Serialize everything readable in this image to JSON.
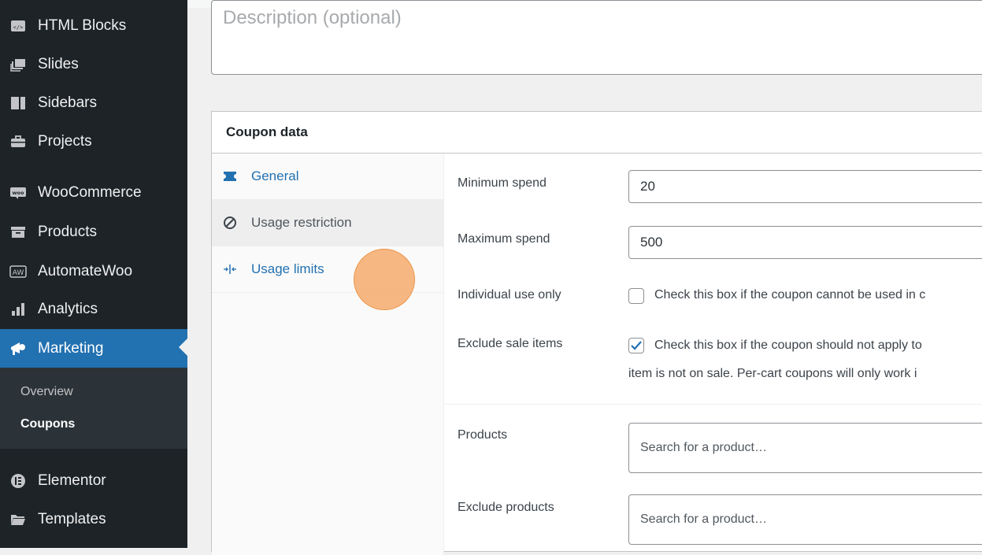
{
  "sidebar": {
    "items": [
      {
        "label": "HTML Blocks",
        "icon": "html-blocks-icon"
      },
      {
        "label": "Slides",
        "icon": "slides-icon"
      },
      {
        "label": "Sidebars",
        "icon": "sidebars-icon"
      },
      {
        "label": "Projects",
        "icon": "briefcase-icon"
      },
      {
        "label": "WooCommerce",
        "icon": "woo-icon"
      },
      {
        "label": "Products",
        "icon": "archive-icon"
      },
      {
        "label": "AutomateWoo",
        "icon": "aw-icon"
      },
      {
        "label": "Analytics",
        "icon": "bar-chart-icon"
      },
      {
        "label": "Marketing",
        "icon": "megaphone-icon"
      },
      {
        "label": "Elementor",
        "icon": "elementor-icon"
      },
      {
        "label": "Templates",
        "icon": "folder-icon"
      }
    ],
    "submenu": [
      {
        "label": "Overview"
      },
      {
        "label": "Coupons"
      }
    ],
    "active_color": "#2271b1"
  },
  "description": {
    "placeholder": "Description (optional)"
  },
  "coupon_data": {
    "title": "Coupon data",
    "tabs": [
      {
        "label": "General",
        "icon": "ticket-icon"
      },
      {
        "label": "Usage restriction",
        "icon": "block-icon"
      },
      {
        "label": "Usage limits",
        "icon": "limits-icon"
      }
    ],
    "fields": {
      "min_spend": {
        "label": "Minimum spend",
        "value": "20"
      },
      "max_spend": {
        "label": "Maximum spend",
        "value": "500"
      },
      "individual_use": {
        "label": "Individual use only",
        "text": "Check this box if the coupon cannot be used in c",
        "checked": false
      },
      "exclude_sale": {
        "label": "Exclude sale items",
        "text": "Check this box if the coupon should not apply to",
        "text2": "item is not on sale. Per-cart coupons will only work i",
        "checked": true
      },
      "products": {
        "label": "Products",
        "placeholder": "Search for a product…"
      },
      "exclude_products": {
        "label": "Exclude products",
        "placeholder": "Search for a product…"
      }
    }
  }
}
